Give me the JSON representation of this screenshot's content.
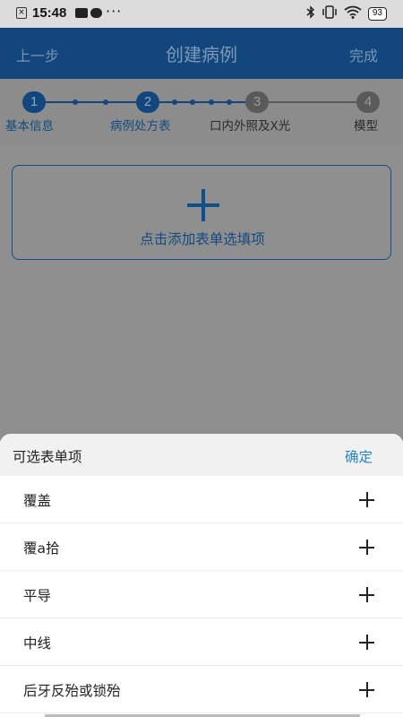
{
  "status_bar": {
    "time": "15:48",
    "more": "···",
    "battery": "93",
    "icons": [
      "screenshot-icon",
      "message-icon",
      "pill-icon",
      "bluetooth-icon",
      "vibrate-icon",
      "wifi-icon",
      "battery-icon"
    ]
  },
  "nav": {
    "back_label": "上一步",
    "title": "创建病例",
    "done_label": "完成"
  },
  "steps": [
    {
      "number": "1",
      "label": "基本信息",
      "state": "done"
    },
    {
      "number": "2",
      "label": "病例处方表",
      "state": "active"
    },
    {
      "number": "3",
      "label": "口内外照及X光",
      "state": "pending"
    },
    {
      "number": "4",
      "label": "模型",
      "state": "pending"
    }
  ],
  "main": {
    "add_form_label": "点击添加表单选填项"
  },
  "sheet": {
    "title": "可选表单项",
    "confirm_label": "确定",
    "options": [
      {
        "label": "覆盖"
      },
      {
        "label": "覆a拾"
      },
      {
        "label": "平导"
      },
      {
        "label": "中线"
      },
      {
        "label": "后牙反殆或锁殆"
      }
    ]
  },
  "colors": {
    "nav_bg": "#12467d",
    "accent": "#2a86c9",
    "overlay": "#8f8f8f"
  }
}
